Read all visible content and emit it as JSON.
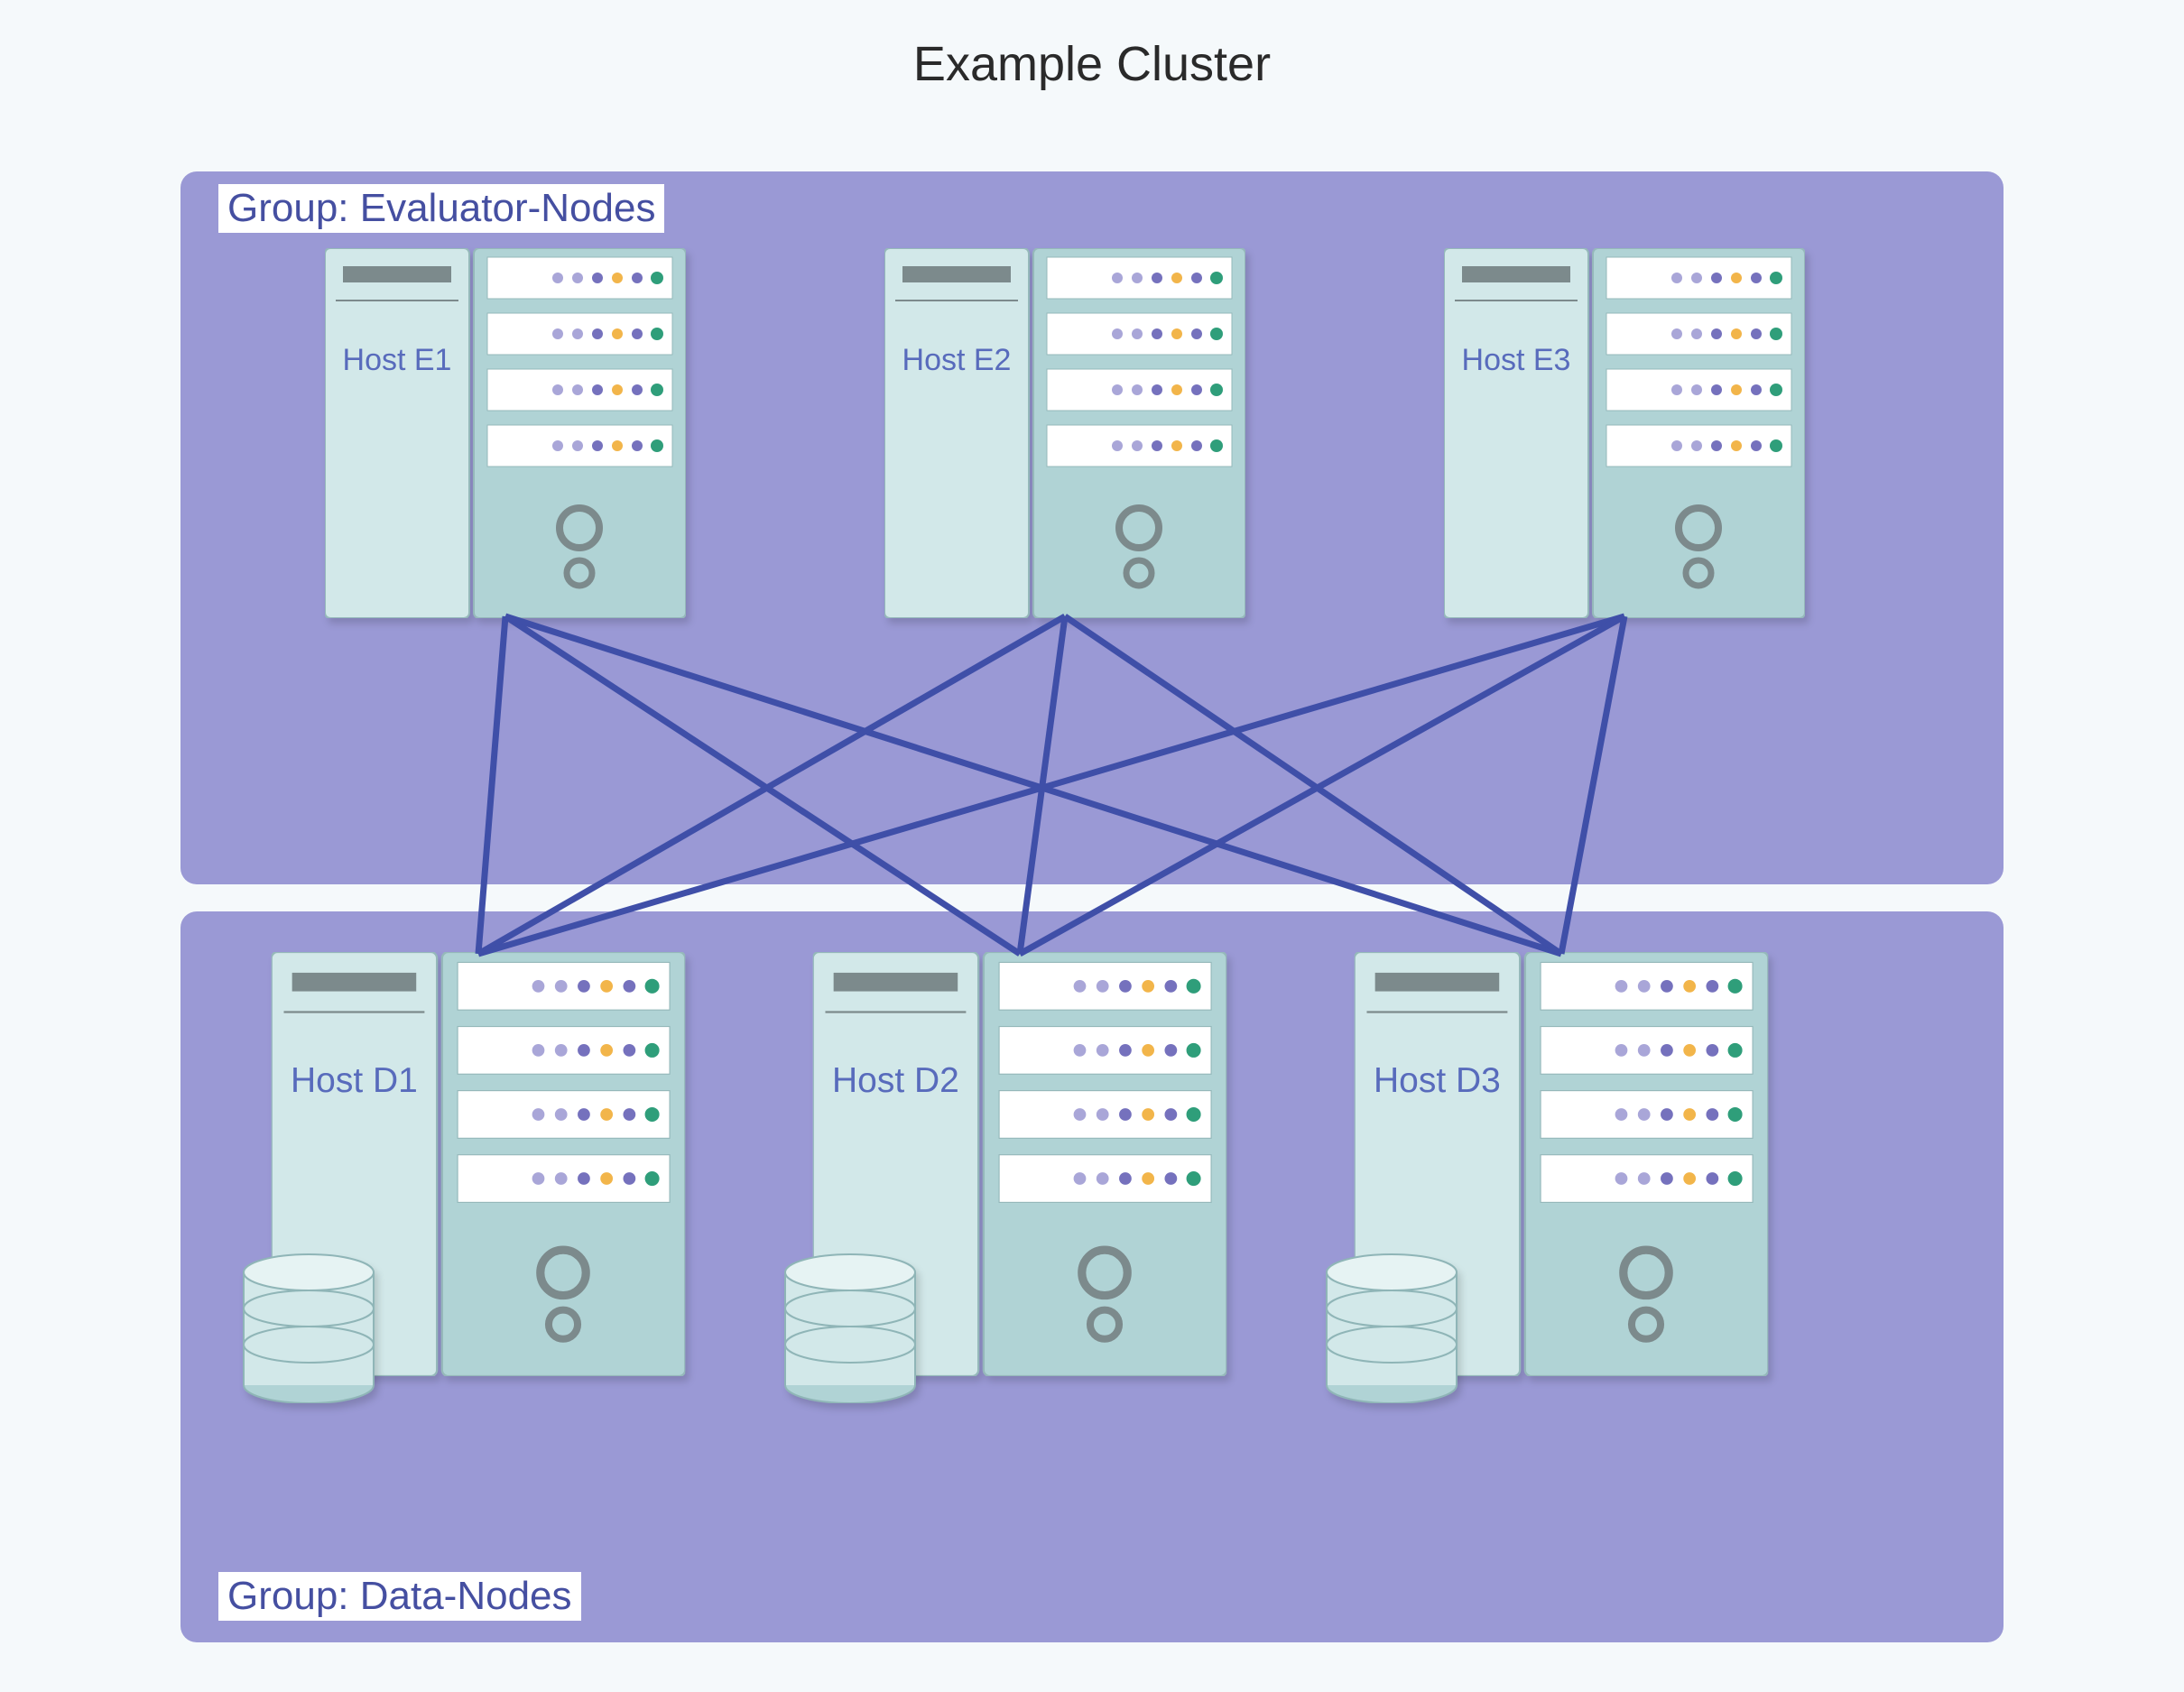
{
  "title": "Example Cluster",
  "groups": {
    "evaluator": {
      "label": "Group: Evaluator-Nodes"
    },
    "data": {
      "label": "Group: Data-Nodes"
    }
  },
  "hosts": {
    "evaluator": [
      {
        "name": "Host E1"
      },
      {
        "name": "Host E2"
      },
      {
        "name": "Host E3"
      }
    ],
    "data": [
      {
        "name": "Host D1"
      },
      {
        "name": "Host D2"
      },
      {
        "name": "Host D3"
      }
    ]
  },
  "colors": {
    "group_bg": "#9a99d5",
    "label_fg": "#454fa1",
    "link": "#3f4fa8",
    "server_left": "#d2e8e9",
    "server_right": "#b0d3d5",
    "slot_bg": "#ffffff",
    "storage": "#d2e8e9"
  },
  "connections": {
    "type": "full-bipartite",
    "description": "Every evaluator node connects to every data node"
  }
}
